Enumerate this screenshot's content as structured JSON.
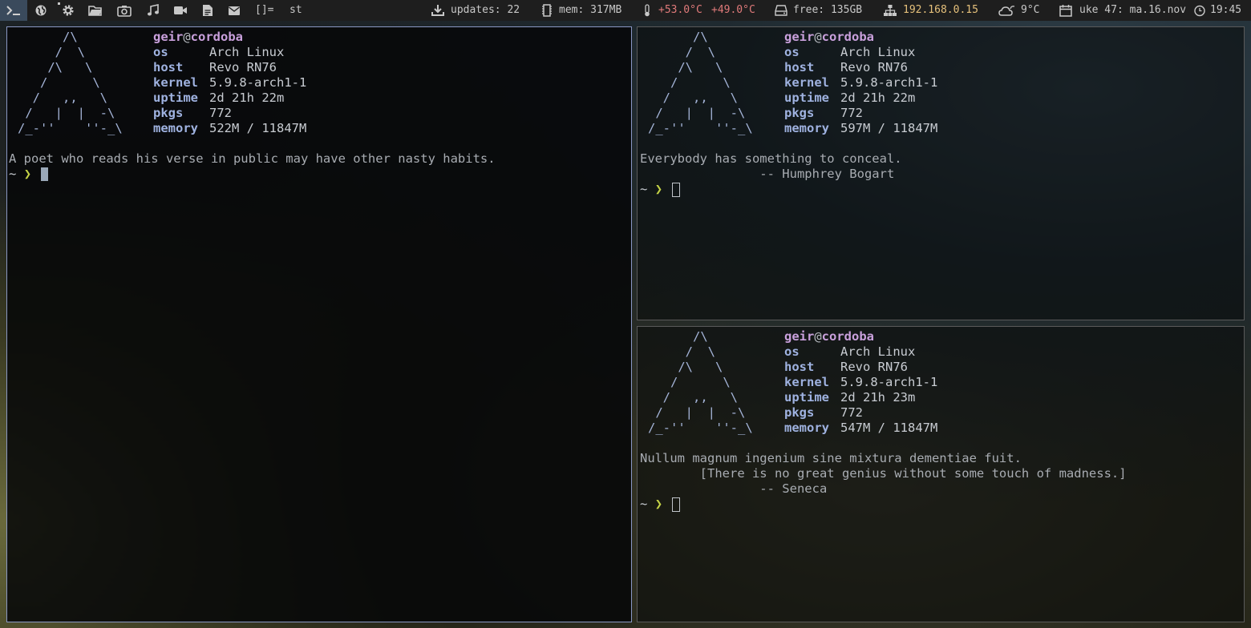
{
  "topbar": {
    "layout_symbol": "[]=",
    "window_title": "st",
    "updates": "updates: 22",
    "mem": "mem: 317MB",
    "temp1": "+53.0°C",
    "temp2": "+49.0°C",
    "disk": "free: 135GB",
    "ip": "192.168.0.15",
    "weather": "9°C",
    "date": "uke 47: ma.16.nov",
    "time": "19:45",
    "tags": [
      "terminal-icon",
      "globe-icon",
      "gear-icon",
      "folder-icon",
      "camera-icon",
      "music-icon",
      "video-icon",
      "document-icon",
      "mail-icon"
    ]
  },
  "panes": {
    "left": {
      "logo": [
        "      /\\",
        "     /  \\",
        "    /\\   \\",
        "   /      \\",
        "  /   ,,   \\",
        " /   |  |  -\\",
        "/_-''    ''-_\\"
      ],
      "user": "geir",
      "at": "@",
      "host": "cordoba",
      "info": [
        {
          "key": "os",
          "value": "Arch Linux"
        },
        {
          "key": "host",
          "value": "Revo RN76"
        },
        {
          "key": "kernel",
          "value": "5.9.8-arch1-1"
        },
        {
          "key": "uptime",
          "value": "2d 21h 22m"
        },
        {
          "key": "pkgs",
          "value": "772"
        },
        {
          "key": "memory",
          "value": "522M / 11847M"
        }
      ],
      "fortune": [
        "A poet who reads his verse in public may have other nasty habits."
      ],
      "prompt_tilde": "~",
      "prompt_chev": "❯"
    },
    "top_right": {
      "logo": [
        "      /\\",
        "     /  \\",
        "    /\\   \\",
        "   /      \\",
        "  /   ,,   \\",
        " /   |  |  -\\",
        "/_-''    ''-_\\"
      ],
      "user": "geir",
      "at": "@",
      "host": "cordoba",
      "info": [
        {
          "key": "os",
          "value": "Arch Linux"
        },
        {
          "key": "host",
          "value": "Revo RN76"
        },
        {
          "key": "kernel",
          "value": "5.9.8-arch1-1"
        },
        {
          "key": "uptime",
          "value": "2d 21h 22m"
        },
        {
          "key": "pkgs",
          "value": "772"
        },
        {
          "key": "memory",
          "value": "597M / 11847M"
        }
      ],
      "fortune": [
        "Everybody has something to conceal.",
        "                -- Humphrey Bogart"
      ],
      "prompt_tilde": "~",
      "prompt_chev": "❯"
    },
    "bottom_right": {
      "logo": [
        "      /\\",
        "     /  \\",
        "    /\\   \\",
        "   /      \\",
        "  /   ,,   \\",
        " /   |  |  -\\",
        "/_-''    ''-_\\"
      ],
      "user": "geir",
      "at": "@",
      "host": "cordoba",
      "info": [
        {
          "key": "os",
          "value": "Arch Linux"
        },
        {
          "key": "host",
          "value": "Revo RN76"
        },
        {
          "key": "kernel",
          "value": "5.9.8-arch1-1"
        },
        {
          "key": "uptime",
          "value": "2d 21h 23m"
        },
        {
          "key": "pkgs",
          "value": "772"
        },
        {
          "key": "memory",
          "value": "547M / 11847M"
        }
      ],
      "fortune": [
        "Nullum magnum ingenium sine mixtura dementiae fuit.",
        "        [There is no great genius without some touch of madness.]",
        "                -- Seneca"
      ],
      "prompt_tilde": "~",
      "prompt_chev": "❯"
    }
  }
}
